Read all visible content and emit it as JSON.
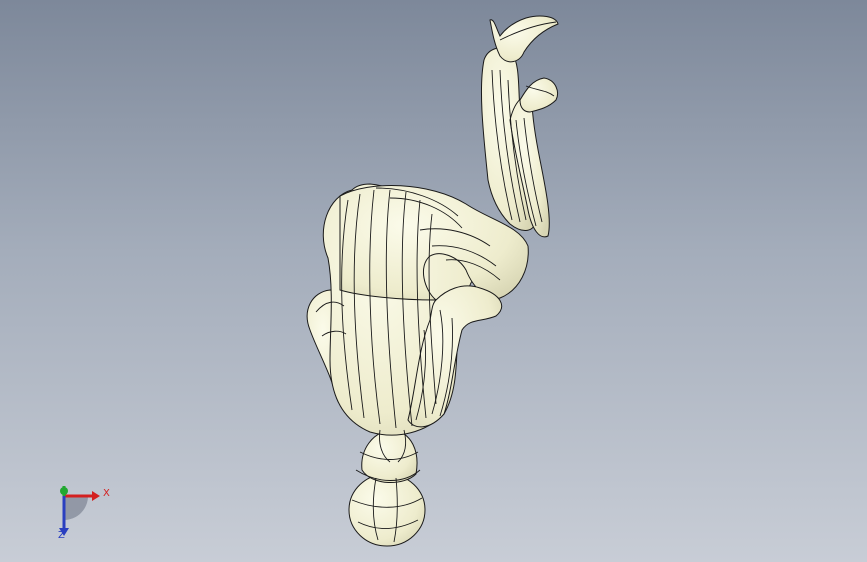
{
  "viewport": {
    "background_top": "#7d889a",
    "background_bottom": "#c8cdd6",
    "model": {
      "description_icon": "3d-figure-model",
      "fill_color": "#f3f2d8",
      "edge_color": "#1a1a1a"
    }
  },
  "triad": {
    "x_label": "X",
    "y_label": "Y",
    "z_label": "Z",
    "x_color": "#d42020",
    "y_color": "#22a830",
    "z_color": "#2a3fc0"
  }
}
